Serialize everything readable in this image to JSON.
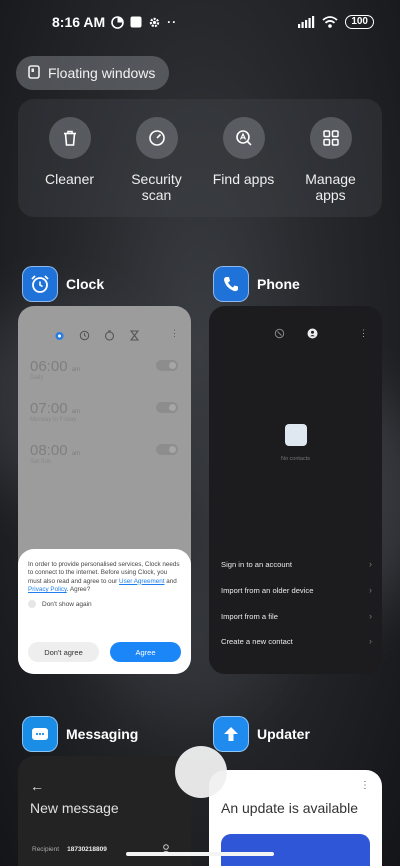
{
  "status_bar": {
    "time": "8:16 AM",
    "battery": "100"
  },
  "floating_windows": {
    "label": "Floating windows"
  },
  "tools": [
    {
      "label": "Cleaner",
      "icon": "trash-icon"
    },
    {
      "label": "Security\nscan",
      "icon": "security-scan-icon"
    },
    {
      "label": "Find apps",
      "icon": "find-apps-icon"
    },
    {
      "label": "Manage\napps",
      "icon": "grid-icon"
    }
  ],
  "apps": {
    "clock": {
      "name": "Clock",
      "alarms": [
        {
          "time": "06:00",
          "ampm": "am",
          "sub": "Daily"
        },
        {
          "time": "07:00",
          "ampm": "am",
          "sub": "Monday to Friday"
        },
        {
          "time": "08:00",
          "ampm": "am",
          "sub": "Sat Sun"
        }
      ],
      "dialog": {
        "text_before": "In order to provide personalised services, Clock needs to connect to the internet. Before using Clock, you must also read and agree to our ",
        "link_user_agreement": "User Agreement",
        "text_and": " and ",
        "link_privacy": "Privacy Policy",
        "text_after": ". Agree?",
        "dont_show_again": "Don't show again",
        "dont_agree": "Don't agree",
        "agree": "Agree"
      }
    },
    "phone": {
      "name": "Phone",
      "no_contacts": "No contacts",
      "options": [
        "Sign in to an account",
        "Import from an older device",
        "Import from a file",
        "Create a new contact"
      ]
    },
    "messaging": {
      "name": "Messaging",
      "title": "New message",
      "recipient_label": "Recipient",
      "recipient_value": "18730218809"
    },
    "updater": {
      "name": "Updater",
      "title": "An update is available"
    }
  },
  "colors": {
    "accent_blue": "#1a86f8",
    "app_icon_bg": "#1d6fd6"
  }
}
